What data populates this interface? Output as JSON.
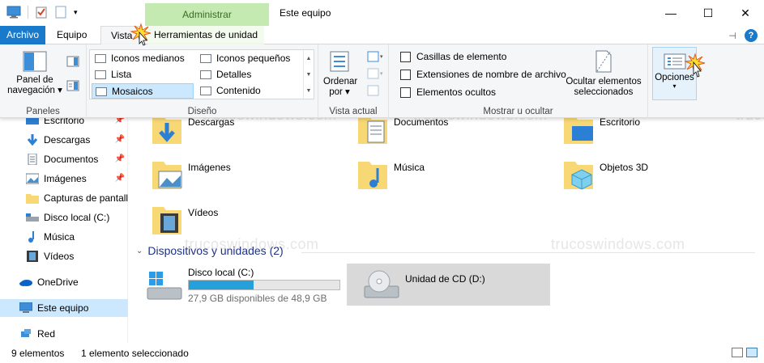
{
  "window": {
    "title": "Este equipo",
    "contextual_group": "Administrar",
    "minimize_glyph": "—",
    "maximize_glyph": "☐",
    "close_glyph": "✕"
  },
  "tabs": {
    "file": "Archivo",
    "equipo": "Equipo",
    "vista": "Vista",
    "herramientas": "Herramientas de unidad"
  },
  "ribbon": {
    "panes": {
      "label": "Paneles",
      "nav_pane_line1": "Panel de",
      "nav_pane_line2": "navegación"
    },
    "layout": {
      "label": "Diseño",
      "items": [
        "Iconos medianos",
        "Iconos pequeños",
        "Lista",
        "Detalles",
        "Mosaicos",
        "Contenido"
      ],
      "selected": "Mosaicos"
    },
    "current_view": {
      "label": "Vista actual",
      "sort_line1": "Ordenar",
      "sort_line2": "por"
    },
    "show_hide": {
      "label": "Mostrar u ocultar",
      "checkboxes": [
        "Casillas de elemento",
        "Extensiones de nombre de archivo",
        "Elementos ocultos"
      ],
      "hide_selected_line1": "Ocultar elementos",
      "hide_selected_line2": "seleccionados"
    },
    "options": {
      "label": "Opciones"
    }
  },
  "nav": {
    "items": [
      {
        "label": "Escritorio",
        "pinned": true
      },
      {
        "label": "Descargas",
        "pinned": true
      },
      {
        "label": "Documentos",
        "pinned": true
      },
      {
        "label": "Imágenes",
        "pinned": true
      },
      {
        "label": "Capturas de pantall",
        "pinned": false
      },
      {
        "label": "Disco local (C:)",
        "pinned": false
      },
      {
        "label": "Música",
        "pinned": false
      },
      {
        "label": "Vídeos",
        "pinned": false
      }
    ],
    "onedrive": "OneDrive",
    "this_pc": "Este equipo",
    "network": "Red"
  },
  "content": {
    "folders": [
      "Descargas",
      "Documentos",
      "Escritorio",
      "Imágenes",
      "Música",
      "Objetos 3D",
      "Vídeos"
    ],
    "devices_header": "Dispositivos y unidades (2)",
    "drives": [
      {
        "name": "Disco local (C:)",
        "free_text": "27,9 GB disponibles de 48,9 GB",
        "used_fraction": 0.43
      },
      {
        "name": "Unidad de CD (D:)"
      }
    ],
    "watermark": "trucoswindows.com"
  },
  "status": {
    "count": "9 elementos",
    "selection": "1 elemento seleccionado"
  },
  "colors": {
    "file_tab": "#1979ca",
    "context_tab": "#c4eab1",
    "selection": "#cce8ff",
    "drive_bar": "#26a0da",
    "folder_yellow": "#f8d775"
  }
}
